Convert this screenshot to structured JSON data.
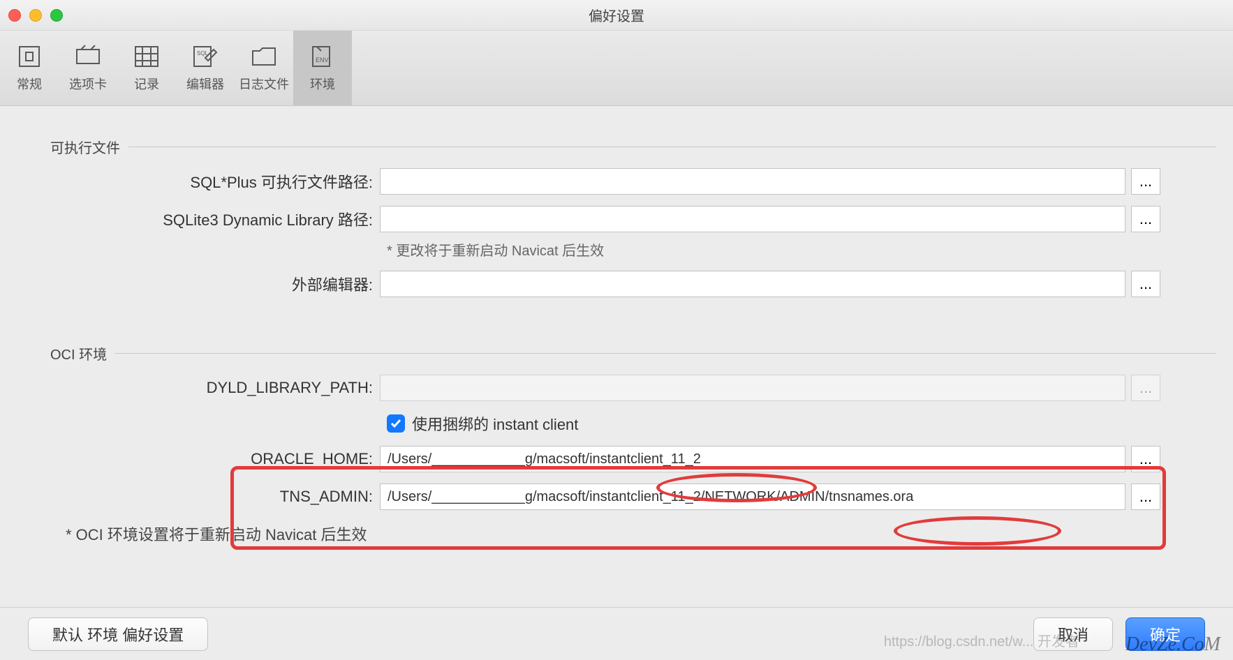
{
  "window": {
    "title": "偏好设置"
  },
  "colors": {
    "accent": "#1279ff",
    "annotate": "#e23b3b"
  },
  "tabs": [
    {
      "label": "常规",
      "icon": "general-icon"
    },
    {
      "label": "选项卡",
      "icon": "tabs-icon"
    },
    {
      "label": "记录",
      "icon": "grid-icon"
    },
    {
      "label": "编辑器",
      "icon": "sql-edit-icon"
    },
    {
      "label": "日志文件",
      "icon": "log-folder-icon"
    },
    {
      "label": "环境",
      "icon": "env-icon",
      "active": true
    }
  ],
  "sections": {
    "exec": {
      "title": "可执行文件",
      "sqlplus_label": "SQL*Plus 可执行文件路径:",
      "sqlplus_value": "",
      "sqlite_label": "SQLite3 Dynamic Library 路径:",
      "sqlite_value": "",
      "sqlite_hint": "* 更改将于重新启动 Navicat 后生效",
      "external_editor_label": "外部编辑器:",
      "external_editor_value": ""
    },
    "oci": {
      "title": "OCI 环境",
      "dyld_label": "DYLD_LIBRARY_PATH:",
      "dyld_value": "",
      "use_bundled_checked": true,
      "use_bundled_label": "使用捆绑的 instant client",
      "oracle_home_label": "ORACLE_HOME:",
      "oracle_home_value": "/Users/____________g/macsoft/instantclient_11_2",
      "tns_admin_label": "TNS_ADMIN:",
      "tns_admin_value": "/Users/____________g/macsoft/instantclient_11_2/NETWORK/ADMIN/tnsnames.ora",
      "note": "* OCI 环境设置将于重新启动 Navicat 后生效"
    }
  },
  "buttons": {
    "browse": "...",
    "default": "默认 环境 偏好设置",
    "cancel": "取消",
    "ok": "确定"
  },
  "watermark": "DevZe.CoM",
  "watermark2": "https://blog.csdn.net/w... 开发者"
}
